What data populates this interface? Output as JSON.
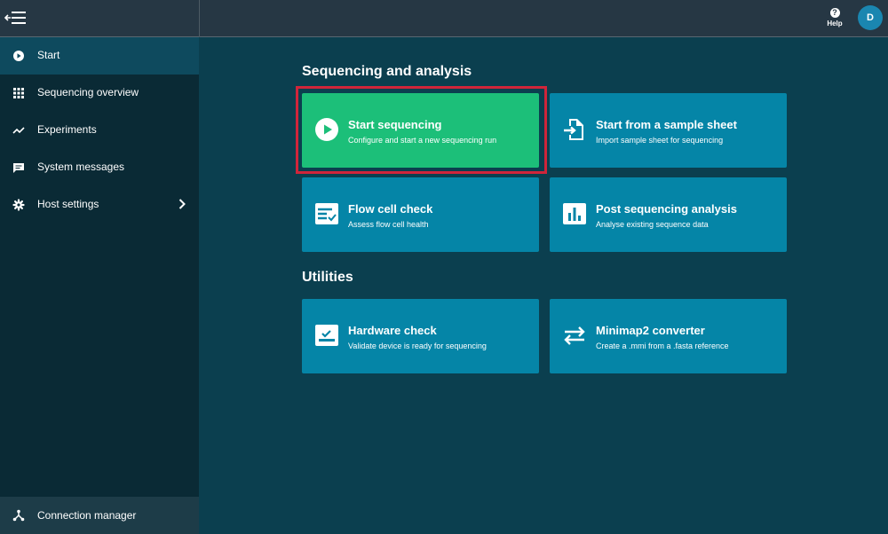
{
  "topbar": {
    "help_label": "Help",
    "help_glyph": "?",
    "avatar_initial": "D"
  },
  "sidebar": {
    "items": [
      {
        "label": "Start",
        "icon": "play-circle-icon",
        "active": true
      },
      {
        "label": "Sequencing overview",
        "icon": "grid-icon"
      },
      {
        "label": "Experiments",
        "icon": "trend-line-icon"
      },
      {
        "label": "System messages",
        "icon": "message-icon"
      },
      {
        "label": "Host settings",
        "icon": "gear-icon"
      }
    ],
    "footer_label": "Connection manager"
  },
  "main": {
    "section1_title": "Sequencing and analysis",
    "section2_title": "Utilities",
    "cards": [
      {
        "title": "Start sequencing",
        "subtitle": "Configure and start a new sequencing run",
        "icon": "play-circle-icon",
        "color": "#1cbf79"
      },
      {
        "title": "Start from a sample sheet",
        "subtitle": "Import sample sheet for sequencing",
        "icon": "file-import-icon",
        "color": "#0585a7"
      },
      {
        "title": "Flow cell check",
        "subtitle": "Assess flow cell health",
        "icon": "flow-cell-icon",
        "color": "#0585a7"
      },
      {
        "title": "Post sequencing analysis",
        "subtitle": "Analyse existing sequence data",
        "icon": "bar-chart-icon",
        "color": "#0585a7"
      },
      {
        "title": "Hardware check",
        "subtitle": "Validate device is ready for sequencing",
        "icon": "hardware-icon",
        "color": "#0585a7"
      },
      {
        "title": "Minimap2 converter",
        "subtitle": "Create a .mmi from a .fasta reference",
        "icon": "swap-arrows-icon",
        "color": "#0585a7"
      }
    ]
  },
  "colors": {
    "background": "#0b3f4f",
    "sidebar": "#0a2a35",
    "card": "#0585a7",
    "card_primary": "#1cbf79",
    "highlight": "#d0253a"
  }
}
